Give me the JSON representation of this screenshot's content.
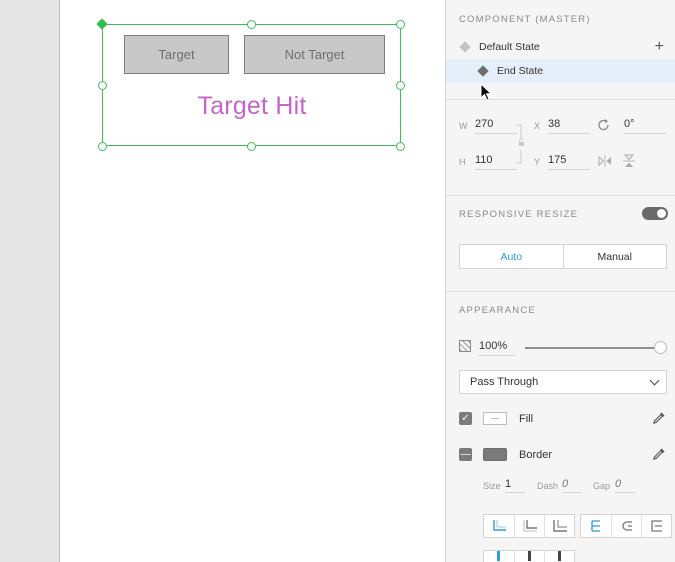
{
  "canvas": {
    "button_target": "Target",
    "button_not_target": "Not Target",
    "hit_text": "Target Hit"
  },
  "component": {
    "section_title": "COMPONENT (MASTER)",
    "states": [
      {
        "label": "Default State"
      },
      {
        "label": "End State"
      }
    ],
    "add_state_icon": "plus-icon"
  },
  "geometry_fields": {
    "w_label": "W",
    "w_value": "270",
    "x_label": "X",
    "x_value": "38",
    "h_label": "H",
    "h_value": "110",
    "y_label": "Y",
    "y_value": "175",
    "rotation_value": "0°"
  },
  "responsive_resize": {
    "title": "RESPONSIVE RESIZE",
    "enabled": true,
    "auto_label": "Auto",
    "manual_label": "Manual"
  },
  "appearance": {
    "title": "APPEARANCE",
    "opacity": "100%",
    "blend_mode": "Pass Through",
    "fill_label": "Fill",
    "border_label": "Border",
    "size_label": "Size",
    "size_value": "1",
    "dash_label": "Dash",
    "dash_value": "0",
    "gap_label": "Gap",
    "gap_value": "0"
  },
  "colors": {
    "selection": "#3ebd5a",
    "target_hit_text": "#c465c9",
    "accent_blue": "#2d9ad9"
  }
}
